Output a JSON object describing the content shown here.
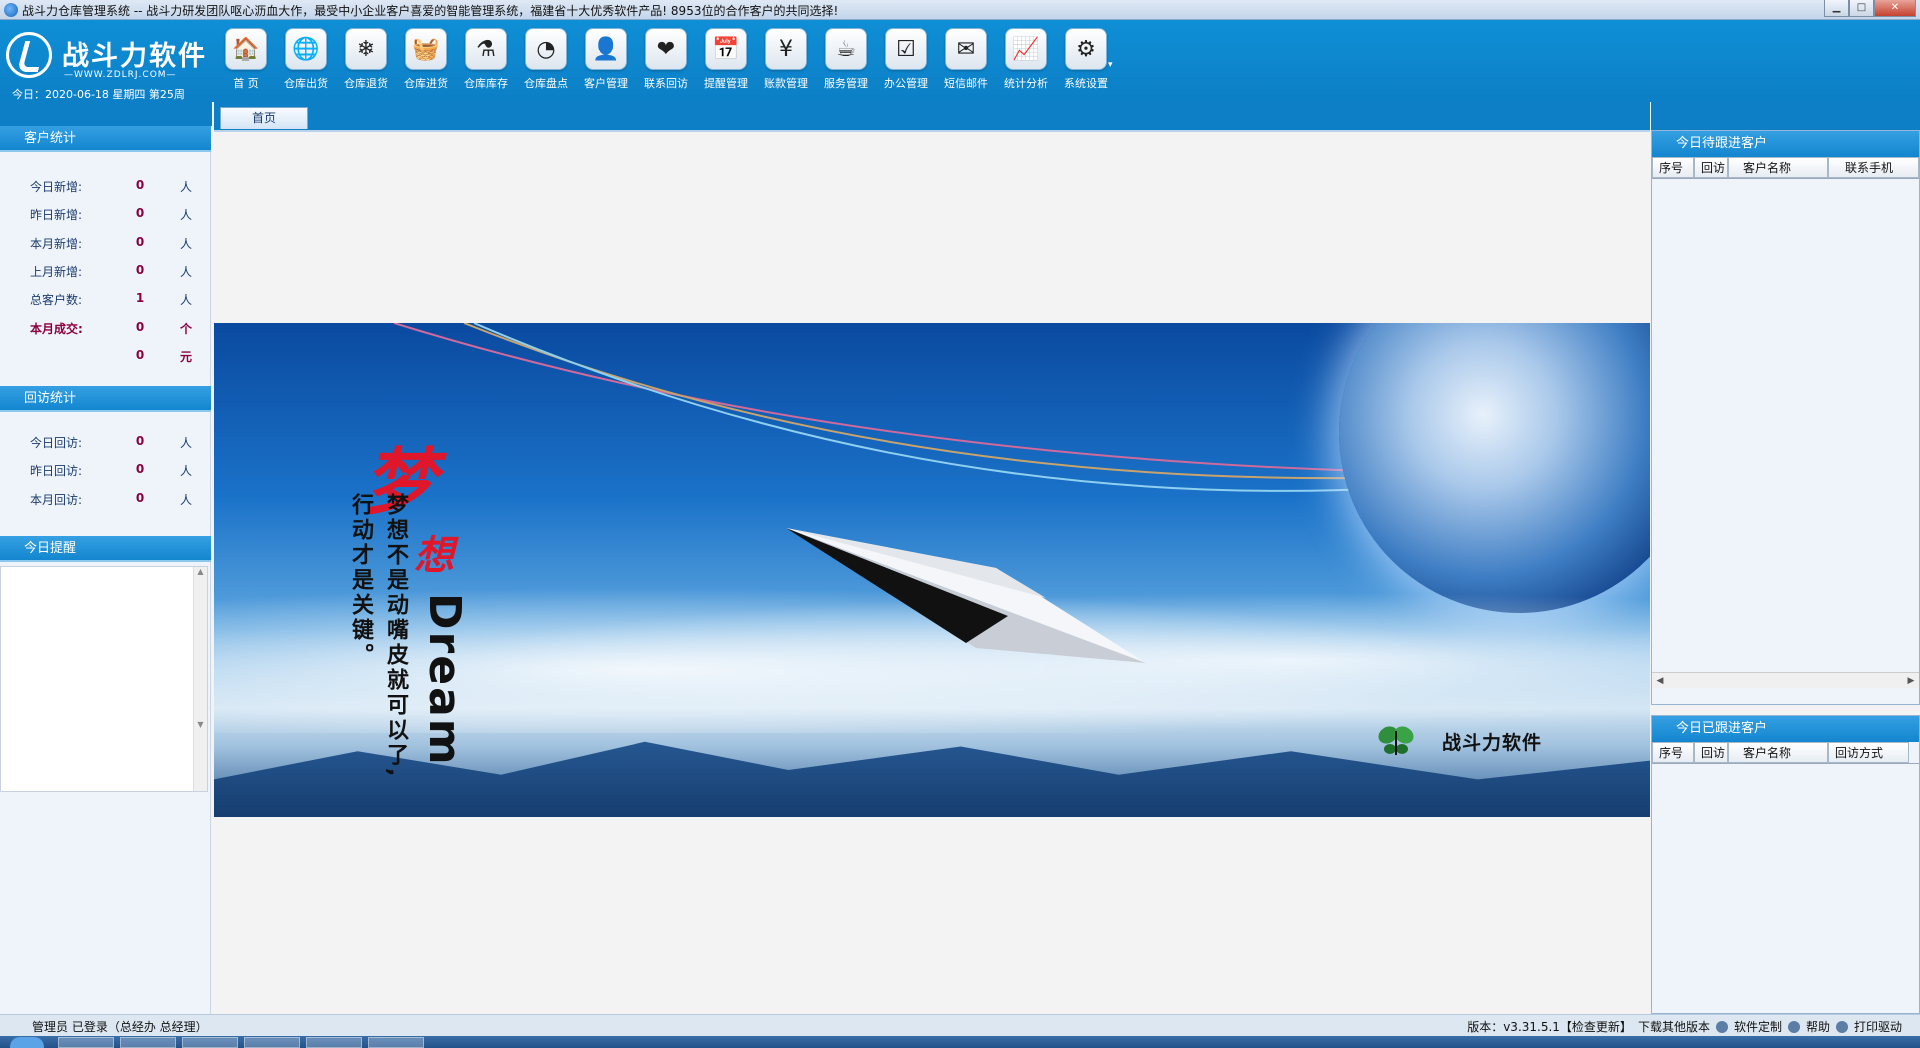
{
  "window": {
    "title": "战斗力仓库管理系统 -- 战斗力研发团队呕心沥血大作，最受中小企业客户喜爱的智能管理系统，福建省十大优秀软件产品! 8953位的合作客户的共同选择!",
    "controls": [
      "minimize",
      "maximize",
      "close"
    ]
  },
  "brand": {
    "name": "战斗力软件",
    "url": "—WWW.ZDLRJ.COM—"
  },
  "date_line": "今日：2020-06-18  星期四  第25周",
  "toolbar": {
    "items": [
      {
        "label": "首 页",
        "icon": "home-icon",
        "glyph": "🏠"
      },
      {
        "label": "仓库出货",
        "icon": "globe-icon",
        "glyph": "🌐"
      },
      {
        "label": "仓库退货",
        "icon": "snowflake-icon",
        "glyph": "❄"
      },
      {
        "label": "仓库进货",
        "icon": "basket-icon",
        "glyph": "🧺"
      },
      {
        "label": "仓库库存",
        "icon": "flask-icon",
        "glyph": "⚗"
      },
      {
        "label": "仓库盘点",
        "icon": "pie-chart-icon",
        "glyph": "◔"
      },
      {
        "label": "客户管理",
        "icon": "person-icon",
        "glyph": "👤"
      },
      {
        "label": "联系回访",
        "icon": "heart-icon",
        "glyph": "❤"
      },
      {
        "label": "提醒管理",
        "icon": "calendar-icon",
        "glyph": "📅"
      },
      {
        "label": "账款管理",
        "icon": "yen-icon",
        "glyph": "¥"
      },
      {
        "label": "服务管理",
        "icon": "coffee-icon",
        "glyph": "☕"
      },
      {
        "label": "办公管理",
        "icon": "checklist-icon",
        "glyph": "☑"
      },
      {
        "label": "短信邮件",
        "icon": "envelope-icon",
        "glyph": "✉"
      },
      {
        "label": "统计分析",
        "icon": "report-icon",
        "glyph": "📈"
      },
      {
        "label": "系统设置",
        "icon": "gears-icon",
        "glyph": "⚙"
      }
    ],
    "more": "▾"
  },
  "tabs": [
    {
      "label": "首页"
    }
  ],
  "customer_stats": {
    "title": "客户统计",
    "rows": [
      {
        "label": "今日新增:",
        "value": "0",
        "unit": "人"
      },
      {
        "label": "昨日新增:",
        "value": "0",
        "unit": "人"
      },
      {
        "label": "本月新增:",
        "value": "0",
        "unit": "人"
      },
      {
        "label": "上月新增:",
        "value": "0",
        "unit": "人"
      },
      {
        "label": "总客户数:",
        "value": "1",
        "unit": "人"
      },
      {
        "label": "本月成交:",
        "value": "0",
        "unit": "个"
      },
      {
        "label": "",
        "value": "0",
        "unit": "元"
      }
    ]
  },
  "visit_stats": {
    "title": "回访统计",
    "rows": [
      {
        "label": "今日回访:",
        "value": "0",
        "unit": "人"
      },
      {
        "label": "昨日回访:",
        "value": "0",
        "unit": "人"
      },
      {
        "label": "本月回访:",
        "value": "0",
        "unit": "人"
      }
    ]
  },
  "reminder": {
    "title": "今日提醒"
  },
  "banner": {
    "big_char_1": "梦",
    "big_char_2": "想",
    "dream_word": "Dream",
    "slogan_1": "梦想不是动嘴皮就可以了,",
    "slogan_2": "行动才是关键。",
    "brand": "战斗力软件"
  },
  "pending_followups": {
    "title": "今日待跟进客户",
    "columns": [
      "序号",
      "回访",
      "客户名称",
      "联系手机"
    ]
  },
  "done_followups": {
    "title": "今日已跟进客户",
    "columns": [
      "序号",
      "回访",
      "客户名称",
      "回访方式"
    ]
  },
  "statusbar": {
    "login": "管理员 已登录（总经办 总经理）",
    "version": "版本：v3.31.5.1【检查更新】",
    "download": "下载其他版本",
    "custom": "软件定制",
    "help": "帮助",
    "print": "打印驱动"
  },
  "colors": {
    "header_blue": "#0f8fd6",
    "section_blue": "#1386cf",
    "stat_value": "#8b0040"
  }
}
